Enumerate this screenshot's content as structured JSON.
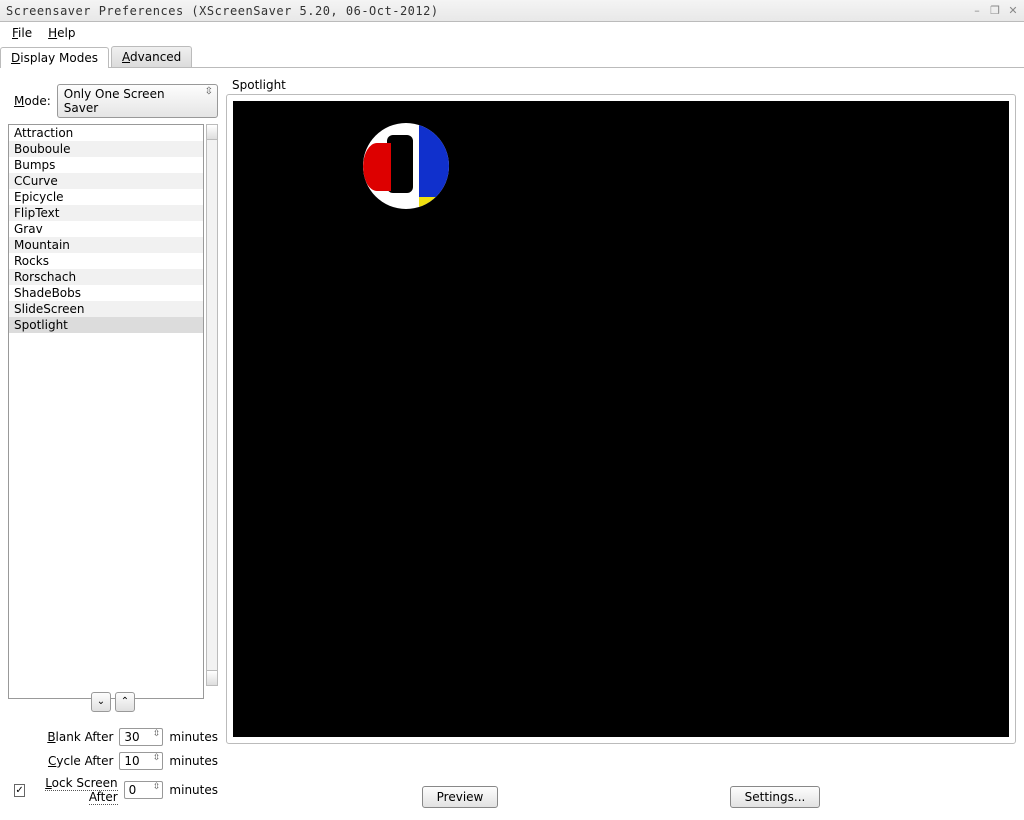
{
  "window": {
    "title": "Screensaver Preferences  (XScreenSaver 5.20, 06-Oct-2012)"
  },
  "menu": {
    "file": "File",
    "help": "Help"
  },
  "tabs": {
    "display": "Display Modes",
    "advanced": "Advanced"
  },
  "mode": {
    "label": "Mode:",
    "value": "Only One Screen Saver"
  },
  "savers": [
    "Attraction",
    "Bouboule",
    "Bumps",
    "CCurve",
    "Epicycle",
    "FlipText",
    "Grav",
    "Mountain",
    "Rocks",
    "Rorschach",
    "ShadeBobs",
    "SlideScreen",
    "Spotlight"
  ],
  "selected_saver": "Spotlight",
  "timing": {
    "blank_label": "Blank After",
    "blank_value": "30",
    "cycle_label": "Cycle After",
    "cycle_value": "10",
    "lock_label": "Lock Screen After",
    "lock_value": "0",
    "lock_checked": true,
    "unit": "minutes"
  },
  "preview": {
    "title": "Spotlight",
    "preview_btn": "Preview",
    "settings_btn": "Settings..."
  },
  "titlebar_icons": {
    "minimize": "–",
    "maximize": "❐",
    "close": "✕"
  }
}
